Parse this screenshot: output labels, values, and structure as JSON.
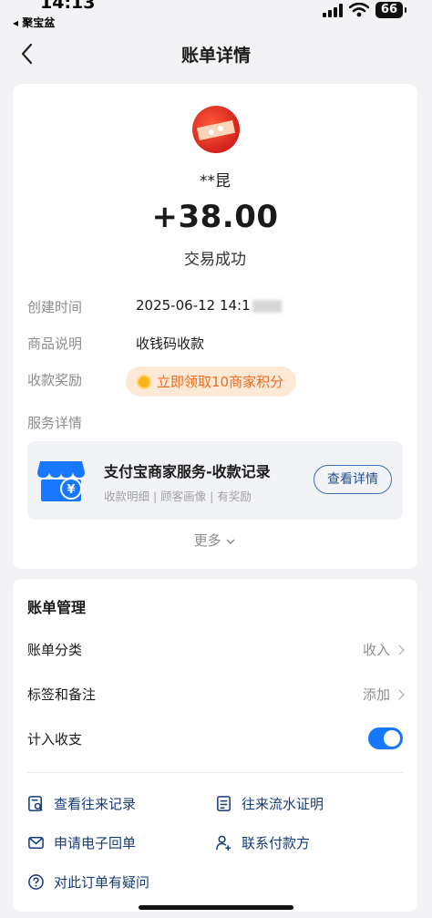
{
  "status_bar": {
    "time": "14:13",
    "back_app": "◂ 聚宝盆",
    "battery": "66"
  },
  "nav": {
    "title": "账单详情",
    "back_icon": "chevron-left-icon"
  },
  "summary": {
    "payer": "**昆",
    "amount": "+38.00",
    "status": "交易成功"
  },
  "details": {
    "create_time_label": "创建时间",
    "create_time_value": "2025-06-12 14:1",
    "product_label": "商品说明",
    "product_value": "收钱码收款",
    "reward_label": "收款奖励",
    "reward_pill": "立即领取10商家积分",
    "service_label": "服务详情"
  },
  "service": {
    "title": "支付宝商家服务-收款记录",
    "subtitle": "收款明细 | 顾客画像 | 有奖励",
    "button": "查看详情"
  },
  "more": "更多",
  "management": {
    "title": "账单管理",
    "category_label": "账单分类",
    "category_value": "收入",
    "tags_label": "标签和备注",
    "tags_value": "添加",
    "include_label": "计入收支",
    "include_enabled": true
  },
  "links": {
    "history": "查看往来记录",
    "statement": "往来流水证明",
    "receipt": "申请电子回单",
    "contact": "联系付款方",
    "question": "对此订单有疑问"
  },
  "colors": {
    "accent": "#1677ff",
    "link": "#163b78",
    "reward": "#f06a1d"
  }
}
